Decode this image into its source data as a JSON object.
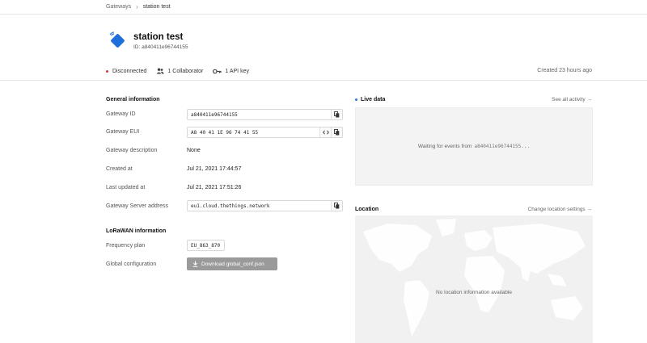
{
  "breadcrumb": {
    "parent": "Gateways",
    "current": "station test"
  },
  "gateway": {
    "name": "station test",
    "id_line": "ID: a840411e96744155",
    "status": "Disconnected",
    "collaborators": "1 Collaborator",
    "api_keys": "1 API key",
    "created_ago": "Created 23 hours ago"
  },
  "general": {
    "title": "General information",
    "fields": {
      "gateway_id": {
        "label": "Gateway ID",
        "value": "a840411e96744155"
      },
      "gateway_eui": {
        "label": "Gateway EUI",
        "value": "A8 40 41 1E 96 74 41 55"
      },
      "description": {
        "label": "Gateway description",
        "value": "None"
      },
      "created_at": {
        "label": "Created at",
        "value": "Jul 21, 2021 17:44:57"
      },
      "updated_at": {
        "label": "Last updated at",
        "value": "Jul 21, 2021 17:51:26"
      },
      "server_address": {
        "label": "Gateway Server address",
        "value": "eu1.cloud.thethings.network"
      }
    }
  },
  "lorawan": {
    "title": "LoRaWAN information",
    "frequency_label": "Frequency plan",
    "frequency_value": "EU_863_870",
    "global_conf_label": "Global configuration",
    "download_label": "Download global_conf.json"
  },
  "live": {
    "title": "Live data",
    "link": "See all activity →",
    "waiting": "Waiting for events from",
    "waiting_id": "a840411e96744155..."
  },
  "location": {
    "title": "Location",
    "link": "Change location settings →",
    "empty": "No location information available"
  },
  "colors": {
    "status_red": "#d63b3b",
    "accent_blue": "#2d7bd6",
    "button_gray": "#9a9a9a"
  }
}
